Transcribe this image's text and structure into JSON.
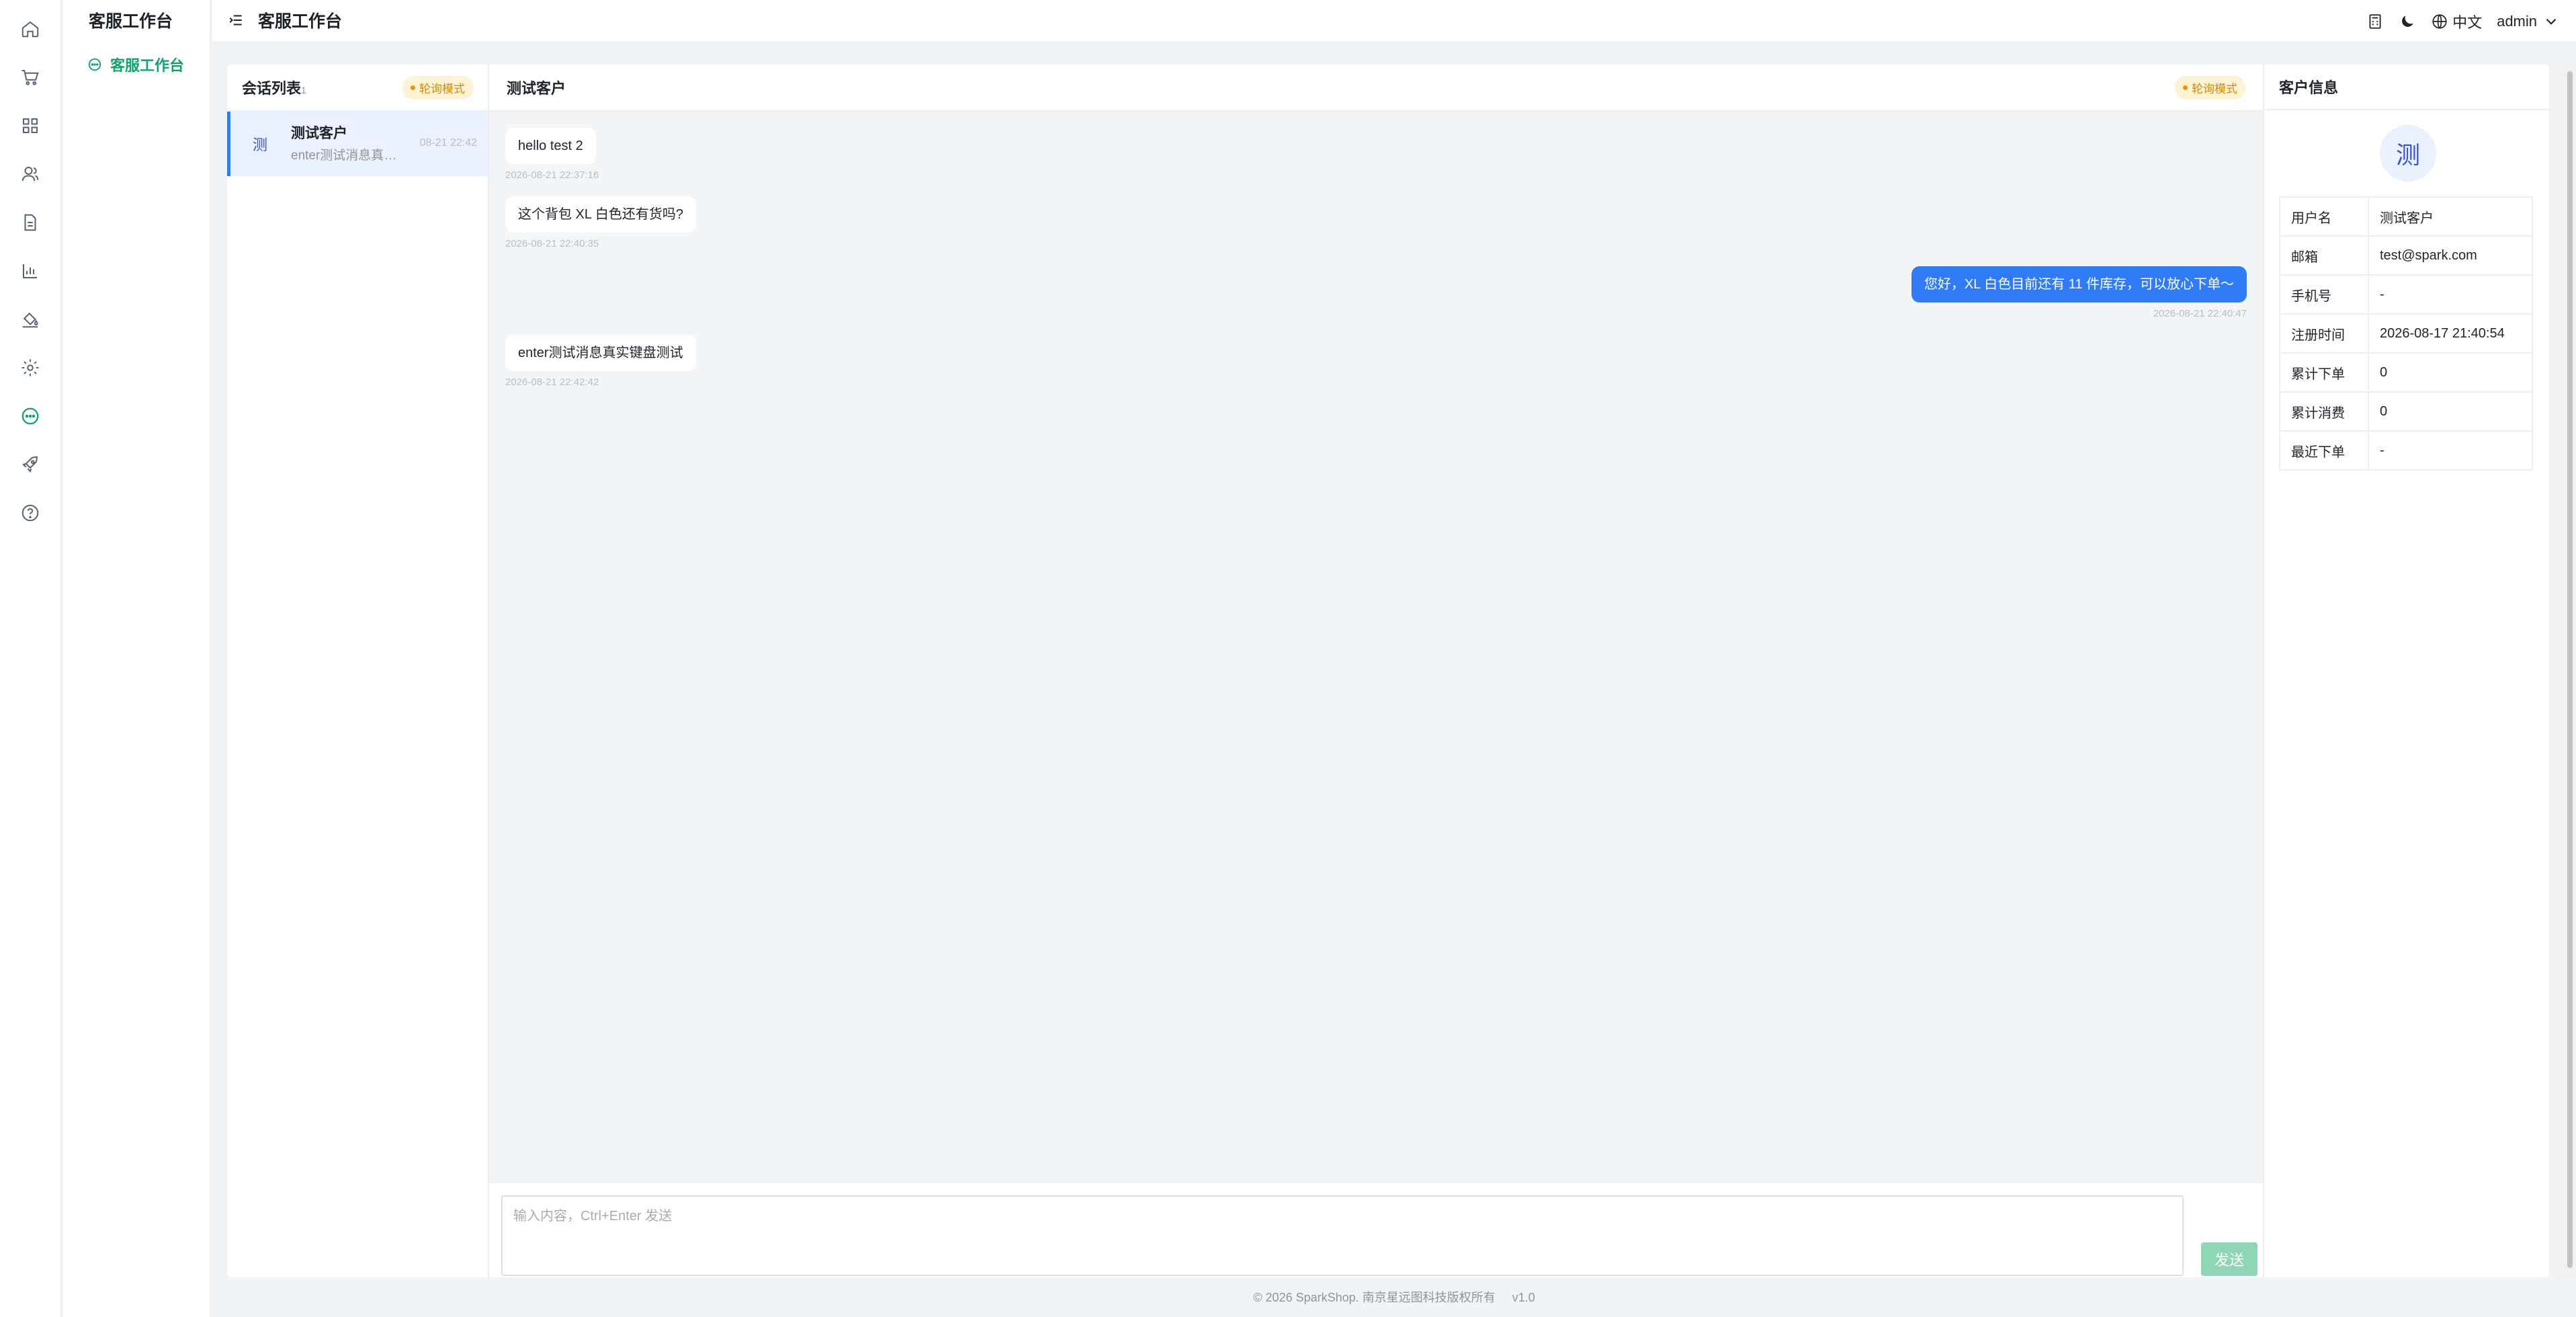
{
  "sidebar": {
    "icons": [
      "home-icon",
      "cart-icon",
      "grid-icon",
      "users-icon",
      "document-icon",
      "chart-icon",
      "paint-bucket-icon",
      "gear-icon",
      "chat-icon",
      "rocket-icon",
      "help-icon"
    ],
    "active_icon": "chat-icon",
    "section_title": "客服工作台",
    "items": [
      {
        "label": "客服工作台",
        "active": true
      }
    ]
  },
  "header": {
    "title": "客服工作台",
    "language": "中文",
    "user": "admin"
  },
  "conversations": {
    "title": "会话列表",
    "title_sup": "1",
    "mode_badge": "轮询模式",
    "items": [
      {
        "avatar": "测",
        "name": "测试客户",
        "preview": "enter测试消息真实键盘测试",
        "time": "08-21 22:42"
      }
    ]
  },
  "chat": {
    "title": "测试客户",
    "mode_badge": "轮询模式",
    "messages": [
      {
        "direction": "in",
        "text": "hello test 2",
        "time": "2026-08-21 22:37:16"
      },
      {
        "direction": "in",
        "text": "这个背包 XL 白色还有货吗?",
        "time": "2026-08-21 22:40:35"
      },
      {
        "direction": "out",
        "text": "您好，XL 白色目前还有 11 件库存，可以放心下单～",
        "time": "2026-08-21 22:40:47"
      },
      {
        "direction": "in",
        "text": "enter测试消息真实键盘测试",
        "time": "2026-08-21 22:42:42"
      }
    ],
    "input_placeholder": "输入内容，Ctrl+Enter 发送",
    "send_label": "发送"
  },
  "customer": {
    "title": "客户信息",
    "avatar": "测",
    "fields": [
      {
        "label": "用户名",
        "value": "测试客户"
      },
      {
        "label": "邮箱",
        "value": "test@spark.com"
      },
      {
        "label": "手机号",
        "value": "-"
      },
      {
        "label": "注册时间",
        "value": "2026-08-17 21:40:54"
      },
      {
        "label": "累计下单",
        "value": "0"
      },
      {
        "label": "累计消费",
        "value": "0"
      },
      {
        "label": "最近下单",
        "value": "-"
      }
    ]
  },
  "footer": {
    "copyright": "© 2026 SparkShop. 南京星远图科技版权所有",
    "version": "v1.0"
  },
  "colors": {
    "accent": "#11a36a",
    "outgoing_bubble": "#2f7cf6",
    "badge_bg": "#fff3d6",
    "badge_text": "#d68a00",
    "send_button": "#8fd6b4"
  }
}
